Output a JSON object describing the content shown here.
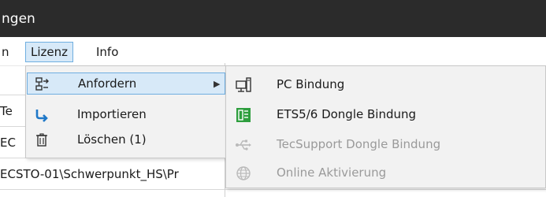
{
  "window": {
    "title": "ngen"
  },
  "menubar": {
    "items": [
      {
        "label": "n"
      },
      {
        "label": "Lizenz"
      },
      {
        "label": "Info"
      }
    ]
  },
  "background": {
    "rows": [
      {
        "text": "Te"
      },
      {
        "text": "EC"
      },
      {
        "text": "ECSTO-01\\Schwerpunkt_HS\\Pr"
      }
    ]
  },
  "lizenz_menu": {
    "items": [
      {
        "label": "Anfordern",
        "icon": "request-license-icon",
        "has_submenu": true
      },
      {
        "label": "Importieren",
        "icon": "import-arrow-icon"
      },
      {
        "label": "Löschen (1)",
        "icon": "trash-icon"
      }
    ]
  },
  "anfordern_submenu": {
    "items": [
      {
        "label": "PC Bindung",
        "icon": "pc-icon",
        "enabled": true
      },
      {
        "label": "ETS5/6 Dongle Bindung",
        "icon": "dongle-ets-icon",
        "enabled": true
      },
      {
        "label": "TecSupport Dongle Bindung",
        "icon": "usb-icon",
        "enabled": false
      },
      {
        "label": "Online Aktivierung",
        "icon": "globe-icon",
        "enabled": false
      }
    ]
  },
  "colors": {
    "titlebar": "#2b2b2b",
    "highlight": "#d7e9f8",
    "highlight_border": "#6faee0",
    "accent_blue": "#1f78c8",
    "green": "#2e9e3e",
    "disabled_text": "#9a9a9a"
  }
}
